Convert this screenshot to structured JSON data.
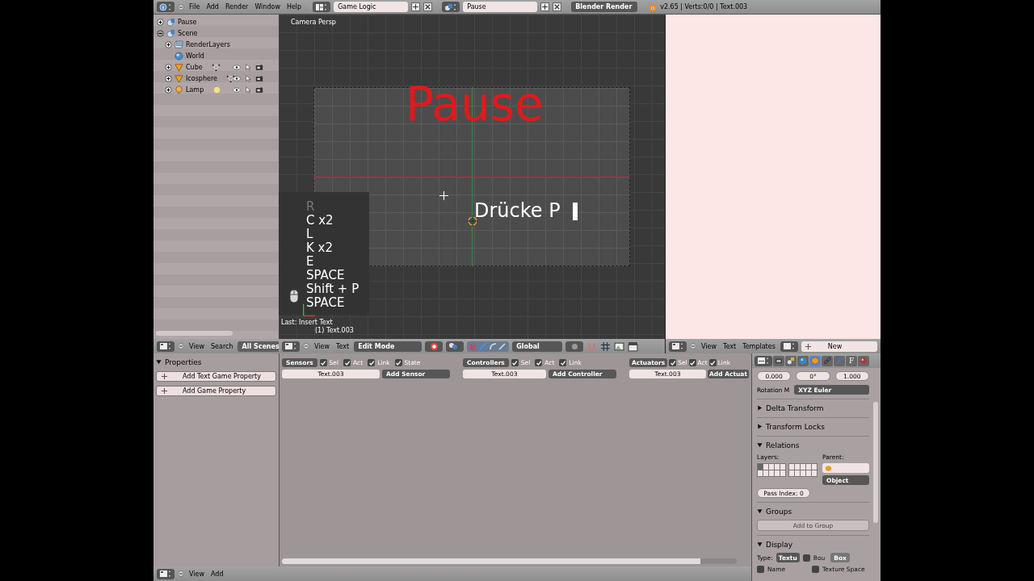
{
  "top_bar": {
    "menus": [
      "File",
      "Add",
      "Render",
      "Window",
      "Help"
    ],
    "layout": "Game Logic",
    "scene": "Pause",
    "engine": "Blender Render",
    "stats": "v2.65 | Verts:0/0 | Text.003"
  },
  "outliner": {
    "items": [
      {
        "label": "Pause",
        "kind": "scene",
        "expanded": false
      },
      {
        "label": "Scene",
        "kind": "scene",
        "expanded": true,
        "children": [
          {
            "label": "RenderLayers",
            "kind": "render_layers",
            "expanded": false
          },
          {
            "label": "World",
            "kind": "world",
            "expanded": false
          },
          {
            "label": "Cube",
            "kind": "mesh",
            "expanded": false
          },
          {
            "label": "Icosphere",
            "kind": "mesh",
            "expanded": false
          },
          {
            "label": "Lamp",
            "kind": "lamp",
            "expanded": false
          }
        ]
      }
    ]
  },
  "outliner_header": {
    "menus": [
      "View",
      "Search"
    ],
    "display": "All Scenes"
  },
  "viewport": {
    "view_label": "Camera Persp",
    "title_text": "Pause",
    "subtitle_text": "Drücke P",
    "keys": [
      {
        "label": "R",
        "faded": true
      },
      {
        "label": "C x2",
        "faded": false
      },
      {
        "label": "L",
        "faded": false
      },
      {
        "label": "K x2",
        "faded": false
      },
      {
        "label": "E",
        "faded": false
      },
      {
        "label": "SPACE",
        "faded": false
      },
      {
        "label": "Shift + P",
        "faded": false
      },
      {
        "label": "SPACE",
        "faded": false
      }
    ],
    "last_operator": "Last: Insert Text",
    "object_label": "(1) Text.003"
  },
  "viewport_header": {
    "menus": [
      "View",
      "Text"
    ],
    "mode": "Edit Mode",
    "orientation": "Global"
  },
  "text_editor_header": {
    "menus": [
      "View",
      "Text",
      "Templates"
    ],
    "new_button": "New"
  },
  "game_properties": {
    "section": "Properties",
    "expanded": true,
    "buttons": [
      "Add Text Game Property",
      "Add Game Property"
    ]
  },
  "logic": {
    "columns": [
      {
        "title": "Sensors",
        "filters": [
          {
            "label": "Sel",
            "checked": true
          },
          {
            "label": "Act",
            "checked": true
          },
          {
            "label": "Link",
            "checked": true
          },
          {
            "label": "State",
            "checked": true
          }
        ],
        "object": "Text.003",
        "add": "Add Sensor"
      },
      {
        "title": "Controllers",
        "filters": [
          {
            "label": "Sel",
            "checked": true
          },
          {
            "label": "Act",
            "checked": true
          },
          {
            "label": "Link",
            "checked": true
          }
        ],
        "object": "Text.003",
        "add": "Add Controller"
      },
      {
        "title": "Actuators",
        "filters": [
          {
            "label": "Sel",
            "checked": true
          },
          {
            "label": "Act",
            "checked": true
          },
          {
            "label": "Link",
            "checked": true
          }
        ],
        "object": "Text.003",
        "add": "Add Actuat"
      }
    ]
  },
  "logic_header": {
    "menus": [
      "View",
      "Add"
    ]
  },
  "properties": {
    "tabs": [
      {
        "kind": "render",
        "selected": false
      },
      {
        "kind": "scene",
        "selected": false
      },
      {
        "kind": "world",
        "selected": false
      },
      {
        "kind": "object",
        "selected": true
      },
      {
        "kind": "constraints",
        "selected": false
      },
      {
        "kind": "modifiers",
        "selected": false
      },
      {
        "kind": "font",
        "label": "F",
        "selected": false
      },
      {
        "kind": "material",
        "selected": false
      }
    ],
    "fields": [
      "0.000",
      "0°",
      "1.000"
    ],
    "rotation_label": "Rotation M",
    "rotation_mode": "XYZ Euler",
    "panels": [
      {
        "title": "Delta Transform",
        "expanded": false
      },
      {
        "title": "Transform Locks",
        "expanded": false
      },
      {
        "title": "Relations",
        "expanded": true,
        "kind": "relations",
        "layers_label": "Layers:",
        "parent_label": "Parent:",
        "parent_type": "Object",
        "pass_index": "Pass Index: 0"
      },
      {
        "title": "Groups",
        "expanded": true,
        "kind": "groups",
        "button": "Add to Group"
      },
      {
        "title": "Display",
        "expanded": true,
        "kind": "display",
        "type_label": "Type:",
        "type_value": "Textu",
        "bounds_type": "Box",
        "options": [
          {
            "label": "Bou",
            "checked": false
          },
          {
            "label": "Name",
            "checked": false
          },
          {
            "label": "Texture Space",
            "checked": false
          }
        ]
      }
    ]
  }
}
